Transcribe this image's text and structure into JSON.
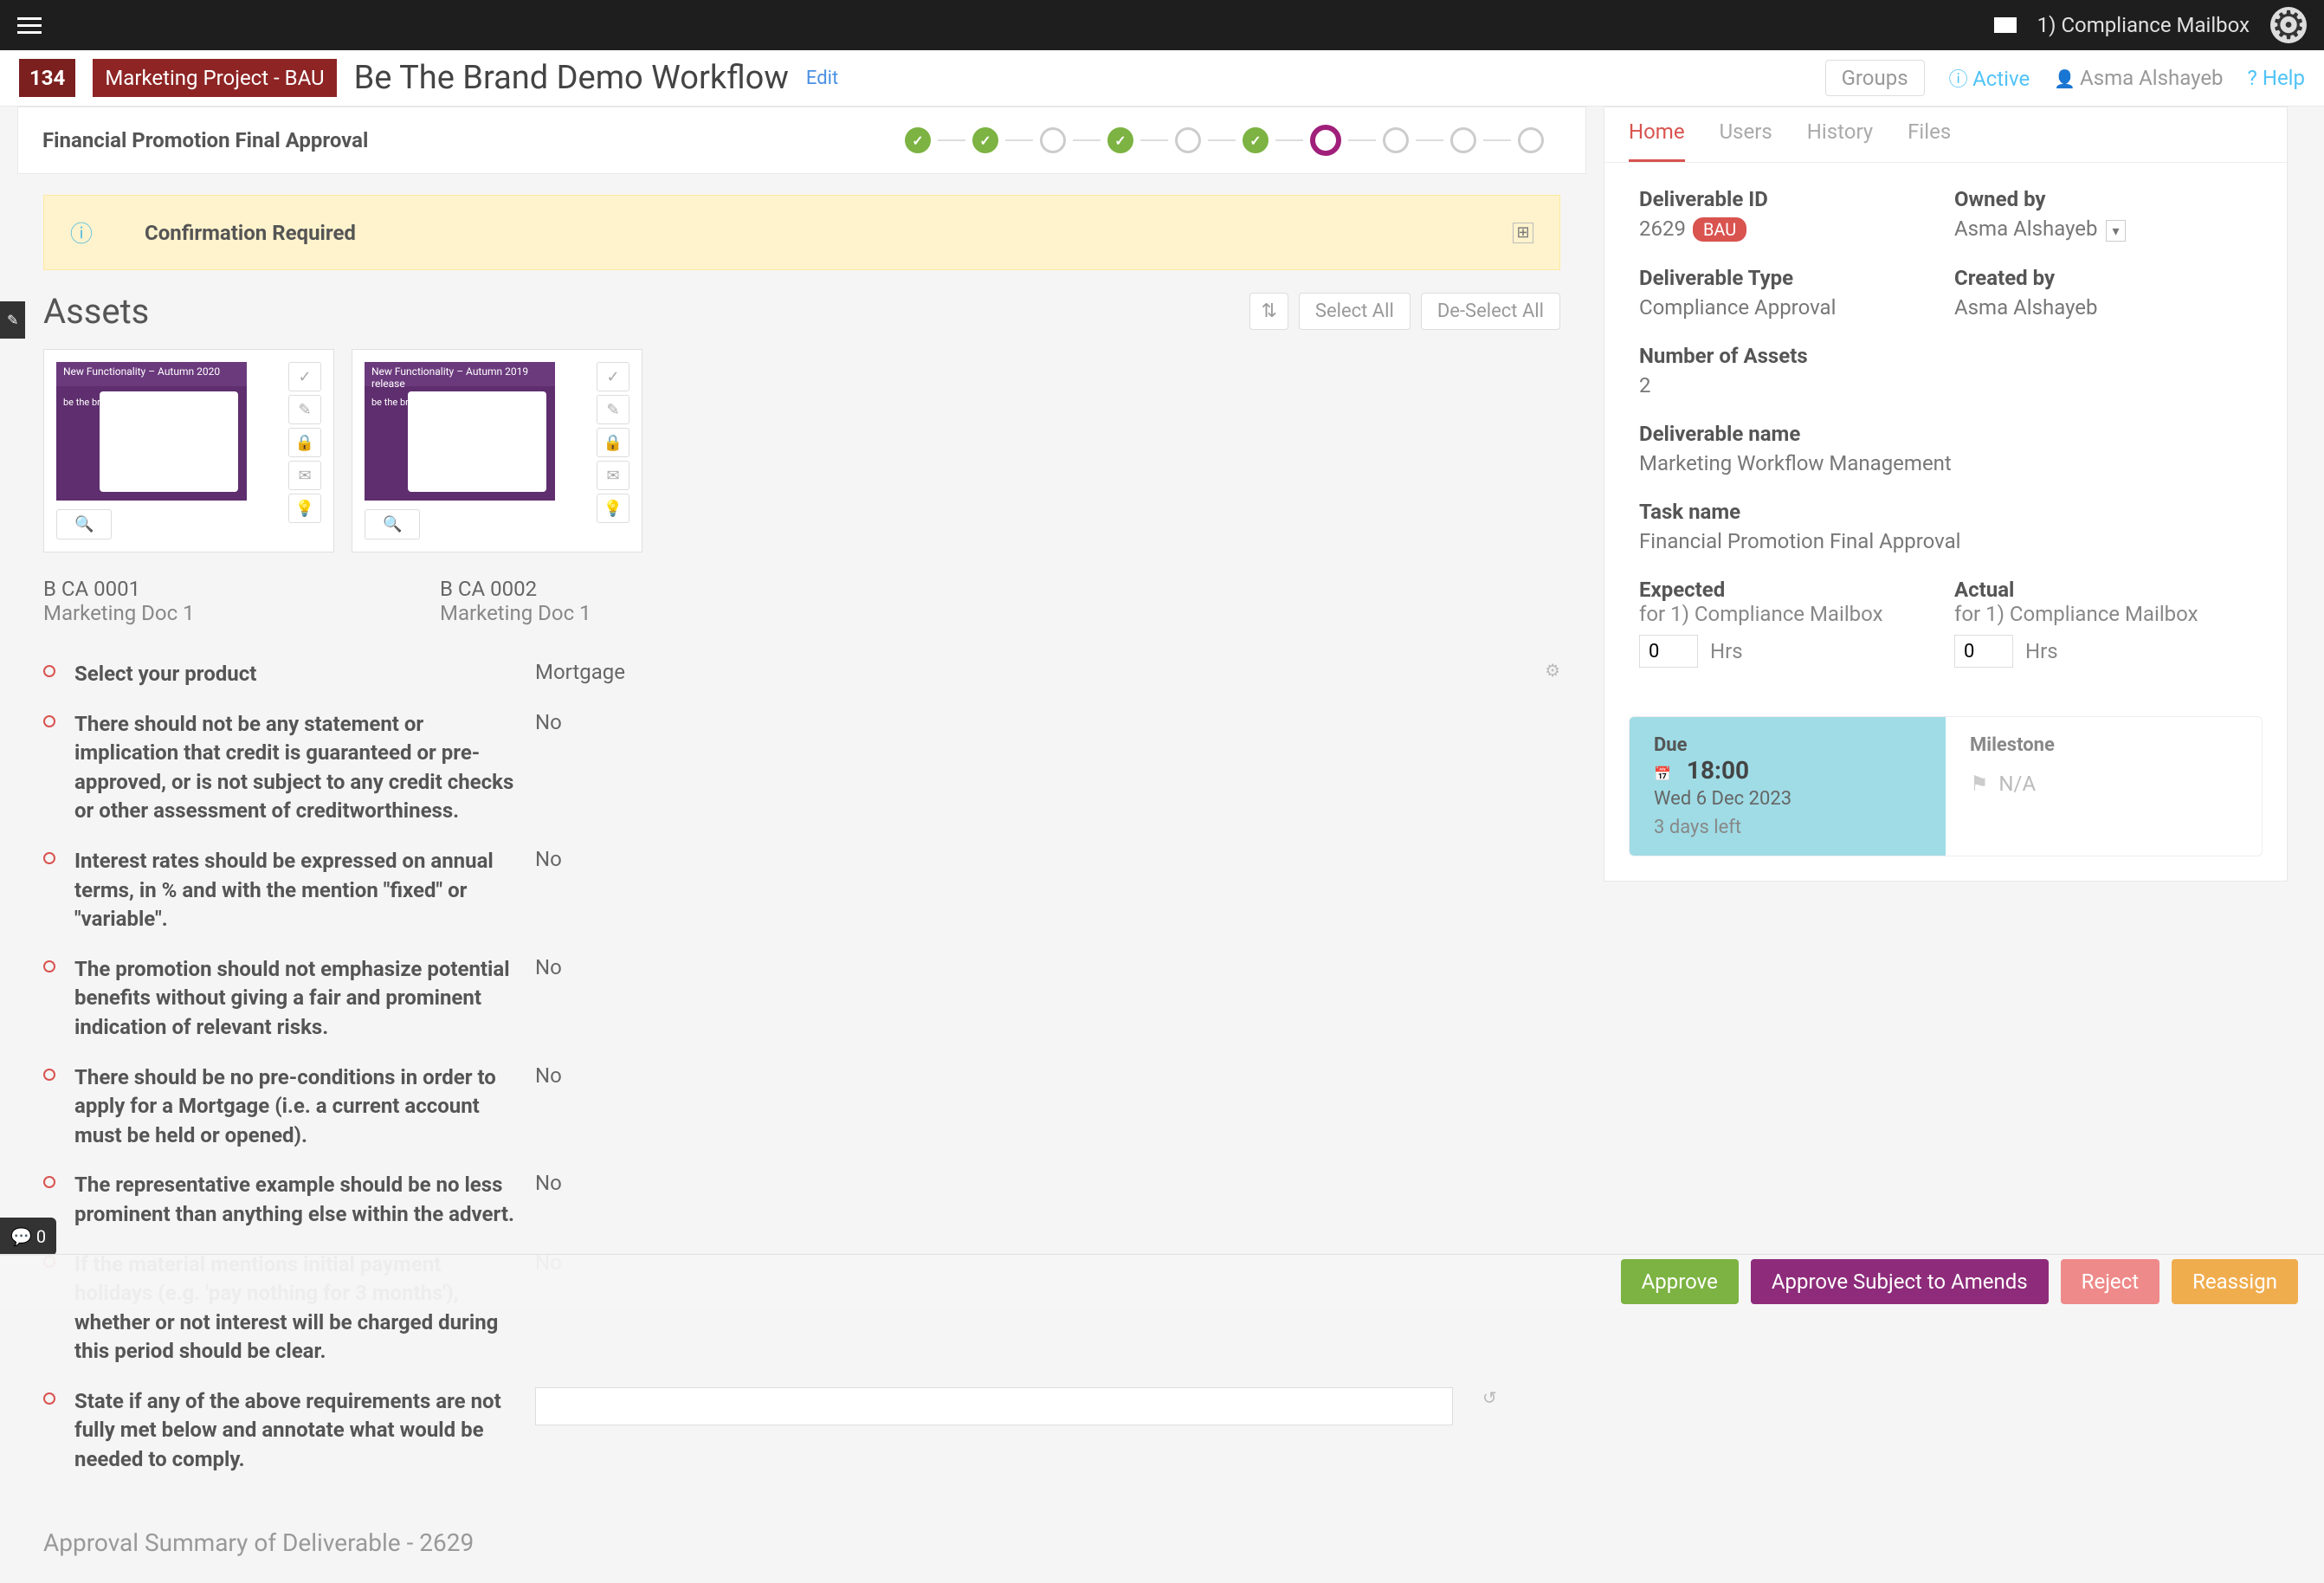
{
  "topbar": {
    "compliance_label": "1) Compliance Mailbox"
  },
  "header": {
    "id": "134",
    "project": "Marketing Project - BAU",
    "title": "Be The Brand Demo Workflow",
    "edit": "Edit",
    "groups": "Groups",
    "status": "Active",
    "user": "Asma Alshayeb",
    "help": "Help"
  },
  "stage": {
    "label": "Financial Promotion Final Approval",
    "steps": [
      "done",
      "done",
      "",
      "done",
      "",
      "done",
      "current",
      "",
      "",
      ""
    ]
  },
  "alert": {
    "label": "Confirmation Required"
  },
  "assets": {
    "title": "Assets",
    "select_all": "Select All",
    "deselect_all": "De-Select All",
    "cards": [
      {
        "code": "B CA 0001",
        "name": "Marketing Doc 1",
        "thumb_top": "New Functionality – Autumn 2020",
        "thumb_tag": "be the brand experience"
      },
      {
        "code": "B CA 0002",
        "name": "Marketing Doc 1",
        "thumb_top": "New Functionality – Autumn 2019 release",
        "thumb_tag": "be the brand experience"
      }
    ]
  },
  "questions": {
    "product_label": "Select your product",
    "product_value": "Mortgage",
    "items": [
      {
        "q": "There should not be any statement or implication that credit is guaranteed or pre-approved, or is not subject to any credit checks or other assessment of creditworthiness.",
        "a": "No"
      },
      {
        "q": "Interest rates should be expressed on annual terms, in % and with the mention \"fixed\" or \"variable\".",
        "a": "No"
      },
      {
        "q": "The promotion should not emphasize potential benefits without giving a fair and prominent indication of relevant risks.",
        "a": "No"
      },
      {
        "q": "There should be no pre-conditions in order to apply for a Mortgage (i.e. a current account must be held or opened).",
        "a": "No"
      },
      {
        "q": "The representative example should be no less prominent than anything else within the advert.",
        "a": "No"
      },
      {
        "q": "If the material mentions initial payment holidays (e.g. 'pay nothing for 3 months'), whether or not interest will be charged during this period should be clear.",
        "a": "No"
      }
    ],
    "state_label": "State if any of the above requirements are not fully met below and annotate what would be needed to comply."
  },
  "tabs": {
    "home": "Home",
    "users": "Users",
    "history": "History",
    "files": "Files"
  },
  "meta": {
    "deliverable_id_label": "Deliverable ID",
    "deliverable_id": "2629",
    "bau": "BAU",
    "owned_by_label": "Owned by",
    "owned_by": "Asma Alshayeb",
    "deliverable_type_label": "Deliverable Type",
    "deliverable_type": "Compliance Approval",
    "created_by_label": "Created by",
    "created_by": "Asma Alshayeb",
    "num_assets_label": "Number of Assets",
    "num_assets": "2",
    "deliverable_name_label": "Deliverable name",
    "deliverable_name": "Marketing Workflow Management",
    "task_name_label": "Task name",
    "task_name": "Financial Promotion Final Approval",
    "expected_label": "Expected",
    "actual_label": "Actual",
    "for_prefix": "for",
    "for_user": "1) Compliance Mailbox",
    "hrs": "Hrs",
    "expected_val": "0",
    "actual_val": "0"
  },
  "due": {
    "due_label": "Due",
    "milestone_label": "Milestone",
    "time": "18:00",
    "date": "Wed 6 Dec 2023",
    "remaining": "3 days left",
    "na": "N/A"
  },
  "summary": {
    "title": "Approval Summary of Deliverable - 2629"
  },
  "actions": {
    "approve": "Approve",
    "approve_amends": "Approve Subject to Amends",
    "reject": "Reject",
    "reassign": "Reassign"
  },
  "chat_count": "0"
}
